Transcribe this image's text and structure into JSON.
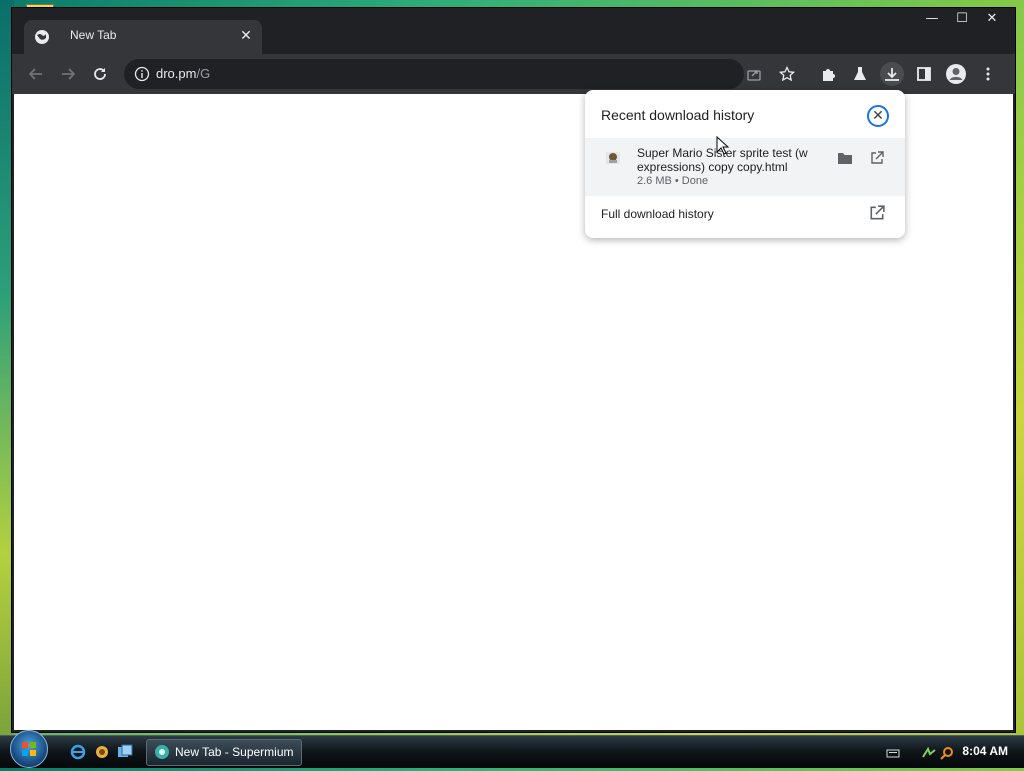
{
  "browser": {
    "tab_title": "New Tab",
    "url_host": "dro.pm",
    "url_path": "/G"
  },
  "downloads": {
    "title": "Recent download history",
    "items": [
      {
        "name": "Super Mario Sister sprite test (w expressions) copy copy.html",
        "meta": "2.6 MB • Done"
      }
    ],
    "full_history_label": "Full download history"
  },
  "taskbar": {
    "task_label": "New Tab - Supermium",
    "clock": "8:04 AM"
  },
  "icons": {
    "back": "arrow-left-icon",
    "forward": "arrow-right-icon",
    "reload": "reload-icon",
    "info": "info-icon",
    "share": "share-icon",
    "bookmark": "star-icon",
    "extensions": "puzzle-icon",
    "labs": "flask-icon",
    "download": "download-icon",
    "side_panel": "side-panel-icon",
    "profile": "profile-icon",
    "menu": "kebab-menu-icon",
    "folder": "folder-icon",
    "open_external": "open-external-icon"
  },
  "colors": {
    "toolbar": "#35363a",
    "frame": "#202124",
    "accent": "#1a73e8"
  }
}
